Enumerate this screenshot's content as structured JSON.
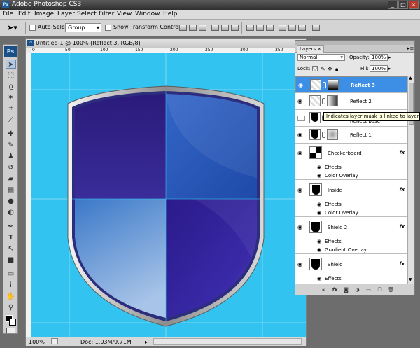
{
  "window": {
    "title": "Adobe Photoshop CS3",
    "app_icon": "Ps",
    "controls": [
      "minimize-icon",
      "maximize-icon",
      "close-icon"
    ]
  },
  "menu": [
    "File",
    "Edit",
    "Image",
    "Layer",
    "Select",
    "Filter",
    "View",
    "Window",
    "Help"
  ],
  "options": {
    "auto_select_label": "Auto-Select:",
    "auto_select_value": "Group",
    "transform_label": "Show Transform Controls"
  },
  "toolbox": {
    "badge": "Ps",
    "tools": [
      "move-icon",
      "marquee-icon",
      "lasso-icon",
      "magic-wand-icon",
      "crop-icon",
      "slice-icon",
      "healing-icon",
      "brush-icon",
      "stamp-icon",
      "history-brush-icon",
      "eraser-icon",
      "gradient-icon",
      "blur-icon",
      "dodge-icon",
      "pen-icon",
      "type-icon",
      "path-select-icon",
      "shape-icon",
      "notes-icon",
      "eyedropper-icon",
      "hand-icon",
      "zoom-icon"
    ]
  },
  "document": {
    "title": "Untitled-1 @ 100% (Reflect 3, RGB/8)",
    "zoom": "100%",
    "doc_size": "Doc: 1,03M/9,71M",
    "canvas_color": "#33c3f0",
    "ruler_marks": [
      "0",
      "50",
      "100",
      "150",
      "200",
      "250",
      "300",
      "350"
    ]
  },
  "layers_panel": {
    "tab": "Layers",
    "blend_mode": "Normal",
    "opacity_label": "Opacity:",
    "opacity": "100%",
    "lock_label": "Lock:",
    "fill_label": "Fill:",
    "fill": "100%",
    "layers": [
      {
        "name": "Reflect 3",
        "selected": true
      },
      {
        "name": "Reflect 2",
        "selected": false
      },
      {
        "name": "Reflect base",
        "selected": false
      },
      {
        "name": "Reflect 1",
        "selected": false
      },
      {
        "name": "Checkerboard",
        "fx": "fx",
        "effects": "Effects",
        "effect": "Color Overlay"
      },
      {
        "name": "Inside",
        "fx": "fx",
        "effects": "Effects",
        "effect": "Color Overlay"
      },
      {
        "name": "Shield 2",
        "fx": "fx",
        "effects": "Effects",
        "effect": "Gradient Overlay"
      },
      {
        "name": "Shield",
        "fx": "fx",
        "effects": "Effects"
      }
    ]
  },
  "tooltip": "Indicates layer mask is linked to layer"
}
